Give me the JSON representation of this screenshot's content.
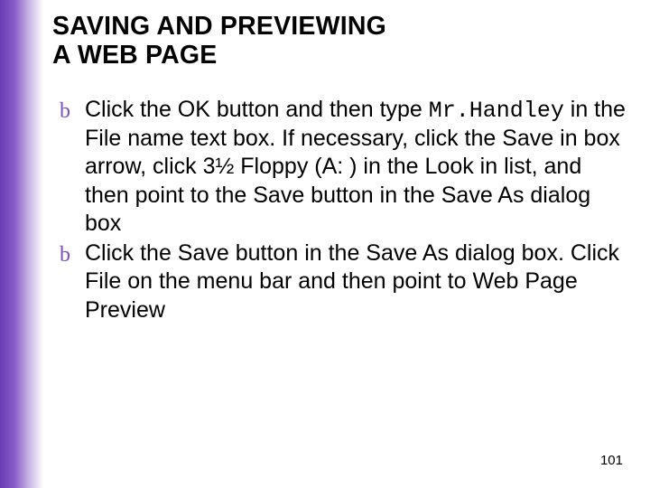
{
  "title_line1": "SAVING AND PREVIEWING",
  "title_line2": "A WEB PAGE",
  "bullets": [
    {
      "marker": "b",
      "pre": "Click the OK button and then type ",
      "code": "Mr.Handley",
      "post": " in the File name text box.  If necessary, click the Save in box arrow, click 3½  Floppy (A: ) in the Look in list, and then point to the Save button in the Save As dialog box"
    },
    {
      "marker": "b",
      "pre": "Click the Save button in the Save As dialog box.  Click File on the menu bar and then point to Web Page Preview",
      "code": "",
      "post": ""
    }
  ],
  "page_number": "101"
}
